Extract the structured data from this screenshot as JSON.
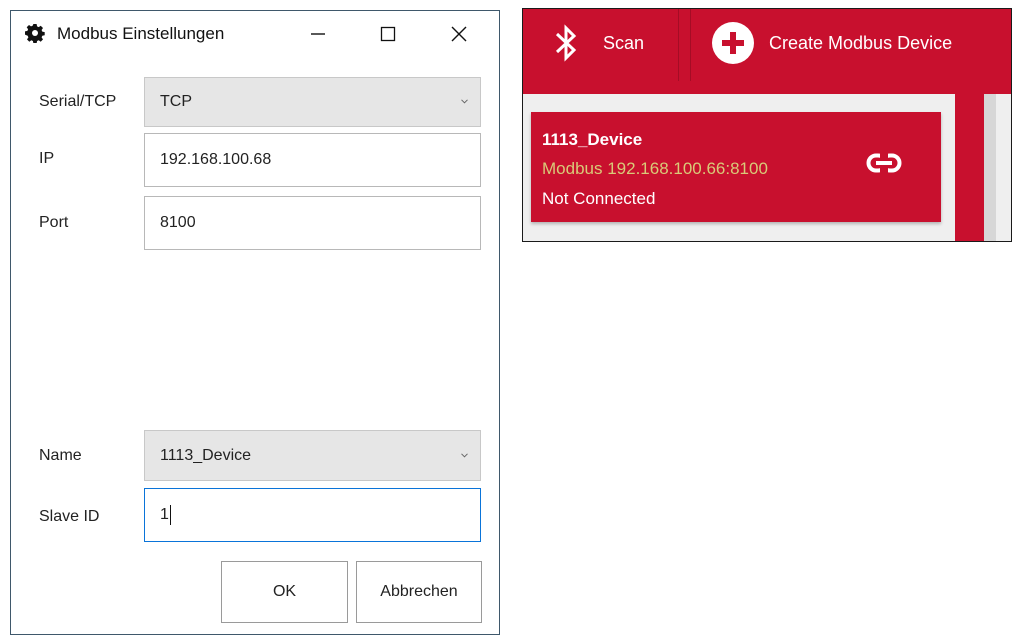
{
  "dialog": {
    "title": "Modbus Einstellungen",
    "icons": {
      "title": "gear-icon",
      "minimize": "minimize-icon",
      "maximize": "maximize-icon",
      "close": "close-icon"
    },
    "fields": {
      "serial_tcp": {
        "label": "Serial/TCP",
        "value": "TCP"
      },
      "ip": {
        "label": "IP",
        "value": "192.168.100.68"
      },
      "port": {
        "label": "Port",
        "value": "8100"
      },
      "name": {
        "label": "Name",
        "value": "1113_Device"
      },
      "slave_id": {
        "label": "Slave ID",
        "value": "1"
      }
    },
    "buttons": {
      "ok": "OK",
      "cancel": "Abbrechen"
    }
  },
  "app": {
    "toolbar": {
      "scan_label": "Scan",
      "scan_icon": "bluetooth-icon",
      "create_label": "Create Modbus Device",
      "create_icon": "plus-circle-icon"
    },
    "device": {
      "name": "1113_Device",
      "address": "Modbus 192.168.100.66:8100",
      "status": "Not Connected",
      "icon": "link-icon"
    }
  },
  "colors": {
    "accent_red": "#c8102e",
    "address_text": "#d9c978",
    "window_border": "#3f586b",
    "focus_border": "#0a74d9"
  }
}
